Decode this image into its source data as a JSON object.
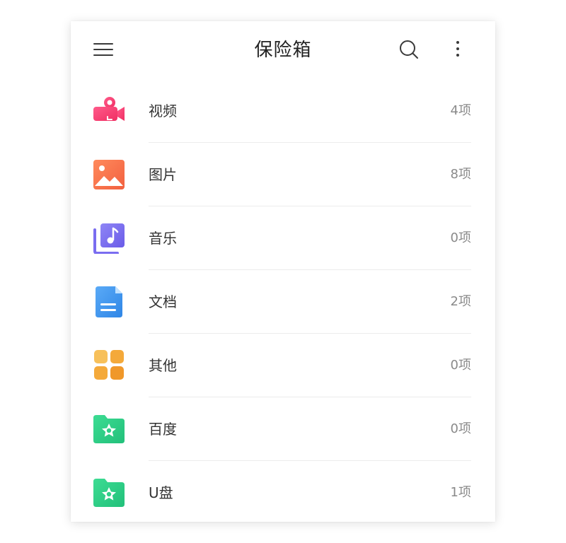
{
  "header": {
    "title": "保险箱",
    "menu_icon": "hamburger-menu-icon",
    "search_icon": "search-icon",
    "more_icon": "more-vertical-icon"
  },
  "items": [
    {
      "label": "视频",
      "count": "4项",
      "icon": "video-camera-icon"
    },
    {
      "label": "图片",
      "count": "8项",
      "icon": "picture-icon"
    },
    {
      "label": "音乐",
      "count": "0项",
      "icon": "music-icon"
    },
    {
      "label": "文档",
      "count": "2项",
      "icon": "document-icon"
    },
    {
      "label": "其他",
      "count": "0项",
      "icon": "grid-apps-icon"
    },
    {
      "label": "百度",
      "count": "0项",
      "icon": "folder-star-icon"
    },
    {
      "label": "U盘",
      "count": "1项",
      "icon": "folder-star-icon"
    }
  ],
  "colors": {
    "video": "#f43f73",
    "picture": "#f76d4c",
    "music": "#7a6df0",
    "document": "#3d96f0",
    "other": "#f5a52d",
    "folder": "#2fcf87",
    "text": "#333333",
    "count": "#8a8a8a"
  }
}
